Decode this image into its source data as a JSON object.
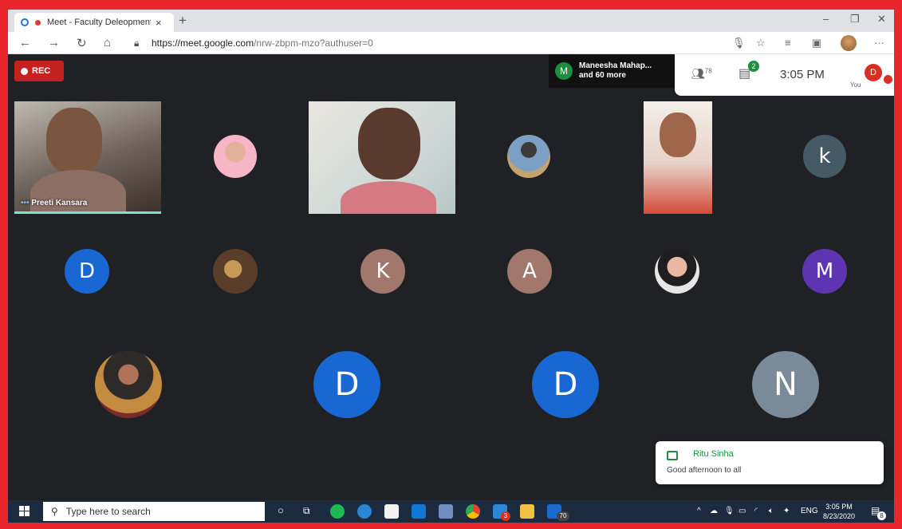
{
  "browser": {
    "tab_title": "Meet - Faculty Deleopment",
    "tab_close": "×",
    "new_tab": "+",
    "minimize": "–",
    "restore": "❐",
    "close": "✕",
    "url_host": "https://meet.google.com",
    "url_path": "/nrw-zbpm-mzo?authuser=0",
    "nav_icons": [
      "back-icon",
      "forward-icon",
      "refresh-icon",
      "home-icon",
      "lock-icon"
    ]
  },
  "meet": {
    "rec_label": "REC",
    "presenter_initial": "M",
    "presenter_line1": "Maneesha Mahap...",
    "presenter_line2": "and 60 more",
    "people_count": "78",
    "chat_badge": "2",
    "time": "3:05 PM",
    "you_label": "You",
    "you_initial": "D"
  },
  "tiles": {
    "preeti_name": "Preeti Kansara",
    "avatars": {
      "k_small": "k",
      "d1": "D",
      "k_big": "K",
      "a": "A",
      "m": "M",
      "d2": "D",
      "d3": "D",
      "n": "N"
    }
  },
  "toast": {
    "name": "Ritu Sinha",
    "message": "Good afternoon to all"
  },
  "taskbar": {
    "search_placeholder": "Type here to search",
    "lang": "ENG",
    "time": "3:05 PM",
    "date": "8/23/2020",
    "notif_count": "8",
    "badge_70": "70",
    "badge_3": "3"
  },
  "colors": {
    "frame_border": "#e8262b",
    "meet_bg": "#202124",
    "green": "#1e8e3e",
    "blue_avatar": "#1967d2",
    "brown_avatar": "#a1786b",
    "purple_avatar": "#5e35b1",
    "gray_avatar": "#7b8a99",
    "slate_avatar": "#455a64"
  }
}
